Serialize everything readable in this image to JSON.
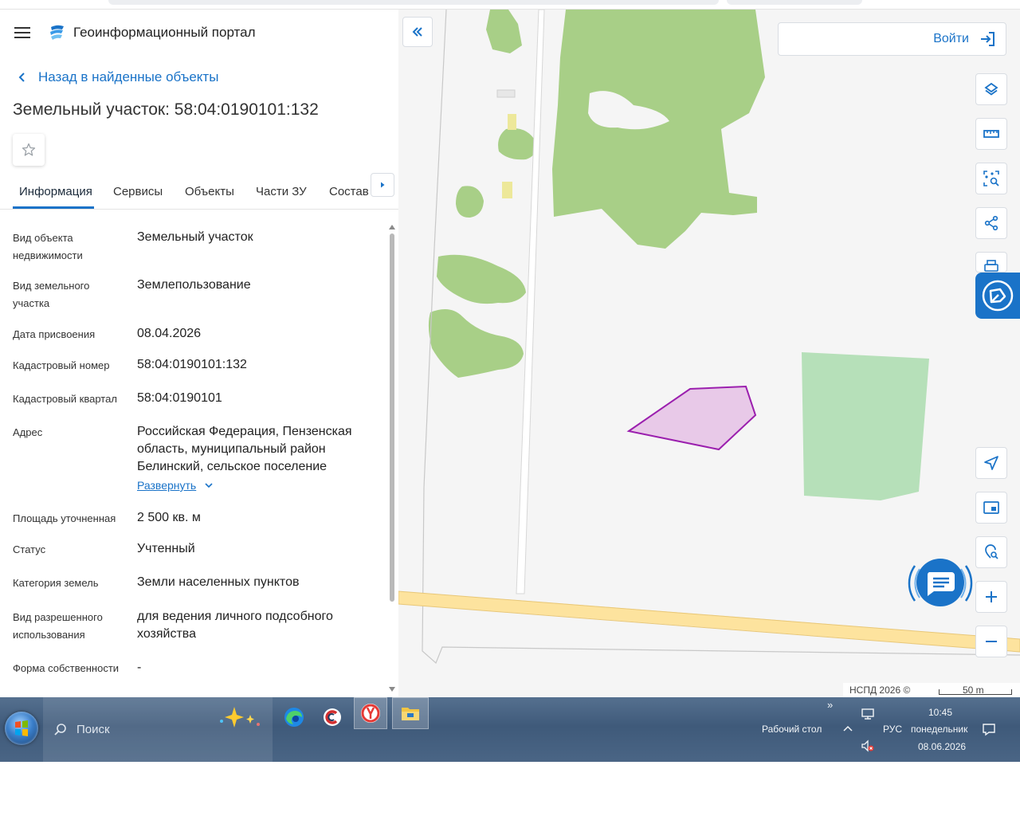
{
  "header": {
    "portal_title": "Геоинформационный портал"
  },
  "back_link": "Назад в найденные объекты",
  "object_title": "Земельный участок: 58:04:0190101:132",
  "tabs": [
    {
      "label": "Информация",
      "active": true
    },
    {
      "label": "Сервисы"
    },
    {
      "label": "Объекты"
    },
    {
      "label": "Части ЗУ"
    },
    {
      "label": "Состав"
    }
  ],
  "properties": [
    {
      "label": "Вид объекта недвижимости",
      "value": "Земельный участок"
    },
    {
      "label": "Вид земельного участка",
      "value": "Землепользование"
    },
    {
      "label": "Дата присвоения",
      "value": "08.04.2026"
    },
    {
      "label": "Кадастровый номер",
      "value": "58:04:0190101:132"
    },
    {
      "label": "Кадастровый квартал",
      "value": "58:04:0190101"
    },
    {
      "label": "Адрес",
      "value": "Российская Федерация, Пензенская область, муниципальный район Белинский, сельское поселение"
    },
    {
      "label": "Площадь уточненная",
      "value": "2 500 кв. м"
    },
    {
      "label": "Статус",
      "value": "Учтенный"
    },
    {
      "label": "Категория земель",
      "value": "Земли населенных пунктов"
    },
    {
      "label": "Вид разрешенного использования",
      "value": "для ведения личного подсобного хозяйства"
    },
    {
      "label": "Форма собственности",
      "value": "-"
    }
  ],
  "expand_label": "Развернуть",
  "map": {
    "login_label": "Войти",
    "attribution": "НСПД 2026 ©",
    "scale_label": "50 m",
    "colors": {
      "background": "#f5f5f5",
      "forest": "#a8cf87",
      "meadow": "#b6e0b9",
      "road": "#fde39e",
      "parcel_fill": "#e8c9e8",
      "parcel_stroke": "#9b1fae",
      "accent": "#1a73c8"
    }
  },
  "taskbar": {
    "search_placeholder": "Поиск",
    "desktop_label": "Рабочий стол",
    "language": "РУС",
    "time": "10:45",
    "weekday": "понедельник",
    "date": "08.06.2026"
  }
}
